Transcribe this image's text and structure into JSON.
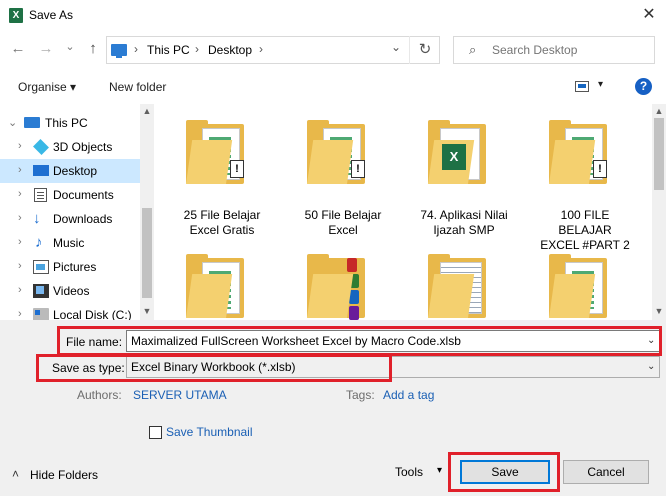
{
  "window": {
    "title": "Save As",
    "app_icon_glyph": "X",
    "close_glyph": "✕"
  },
  "nav": {
    "back_glyph": "←",
    "forward_glyph": "→",
    "recent_glyph": "⌄",
    "up_glyph": "↑",
    "breadcrumb": [
      "This PC",
      "Desktop"
    ],
    "breadcrumb_sep": "›",
    "dropdown_glyph": "⌄",
    "refresh_glyph": "↻",
    "search_icon_glyph": "⌕",
    "search_placeholder": "Search Desktop"
  },
  "toolbar": {
    "organise_label": "Organise ▾",
    "new_folder_label": "New folder",
    "view_dropdown_glyph": "▾",
    "help_glyph": "?"
  },
  "sidebar": {
    "items": [
      {
        "label": "This PC",
        "icon": "computer-icon",
        "selected": false
      },
      {
        "label": "3D Objects",
        "icon": "cube-icon",
        "selected": false
      },
      {
        "label": "Desktop",
        "icon": "desktop-icon",
        "selected": true
      },
      {
        "label": "Documents",
        "icon": "document-icon",
        "selected": false
      },
      {
        "label": "Downloads",
        "icon": "download-icon",
        "selected": false
      },
      {
        "label": "Music",
        "icon": "music-icon",
        "selected": false
      },
      {
        "label": "Pictures",
        "icon": "pictures-icon",
        "selected": false
      },
      {
        "label": "Videos",
        "icon": "videos-icon",
        "selected": false
      },
      {
        "label": "Local Disk (C:)",
        "icon": "disk-icon",
        "selected": false
      }
    ],
    "chevron_glyph": "›",
    "expanded_glyph": "⌄",
    "scroll_up_glyph": "▲",
    "scroll_down_glyph": "▼"
  },
  "files": [
    {
      "line1": "25 File Belajar",
      "line2": "Excel Gratis",
      "type": "folder-excel"
    },
    {
      "line1": "50 File Belajar",
      "line2": "Excel",
      "type": "folder-excel"
    },
    {
      "line1": "74. Aplikasi Nilai",
      "line2": "Ijazah SMP",
      "type": "folder-xlsx"
    },
    {
      "line1": "100 FILE BELAJAR",
      "line2": "EXCEL #PART 2",
      "type": "folder-excel"
    },
    {
      "line1": "",
      "line2": "",
      "type": "folder-plain"
    },
    {
      "line1": "",
      "line2": "",
      "type": "folder-binders"
    },
    {
      "line1": "",
      "line2": "",
      "type": "folder-docs"
    },
    {
      "line1": "",
      "line2": "",
      "type": "folder-plain"
    }
  ],
  "badge_glyph": "!",
  "xlsx_glyph": "X",
  "form": {
    "file_name_label": "File name:",
    "file_name_value": "Maximalized FullScreen Worksheet Excel by Macro Code.xlsb",
    "save_type_label": "Save as type:",
    "save_type_value": "Excel Binary Workbook (*.xlsb)",
    "authors_label": "Authors:",
    "authors_value": "SERVER UTAMA",
    "tags_label": "Tags:",
    "tags_value": "Add a tag",
    "thumbnail_label": "Save Thumbnail",
    "hide_folders_label": "Hide Folders",
    "hide_folders_glyph": "˄",
    "tools_label": "Tools",
    "tools_glyph": "▾",
    "save_label": "Save",
    "cancel_label": "Cancel",
    "dropdown_glyph": "⌄"
  },
  "colors": {
    "highlight_red": "#e0202a",
    "selection_blue": "#cce8ff",
    "link_blue": "#1a5fb4",
    "folder_yellow": "#e8b84a"
  }
}
